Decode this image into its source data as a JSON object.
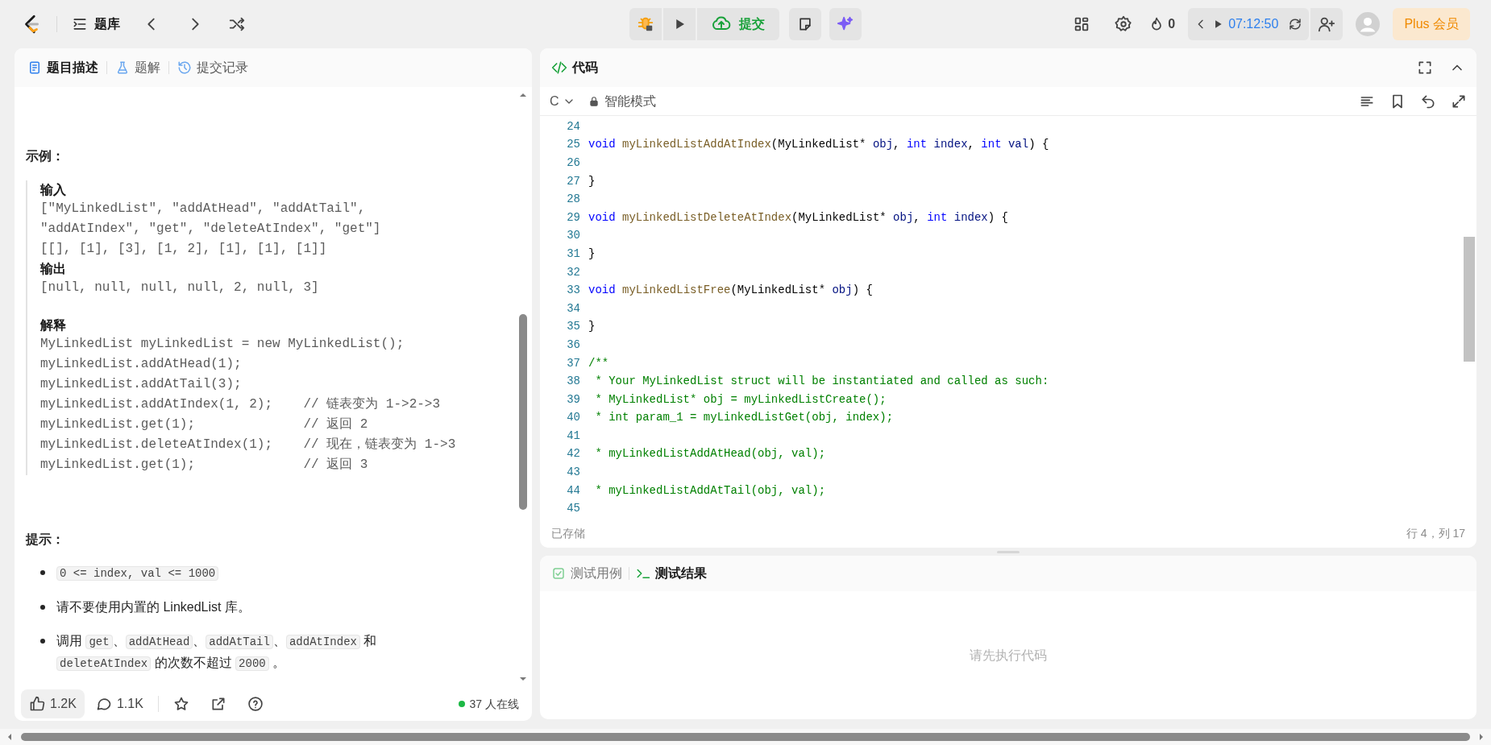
{
  "topbar": {
    "section": "题库",
    "submit": "提交",
    "streak": "0",
    "timer": "07:12:50",
    "plus": "Plus 会员"
  },
  "problem_panel": {
    "tabs": [
      {
        "label": "题目描述",
        "selected": true
      },
      {
        "label": "题解",
        "selected": false
      },
      {
        "label": "提交记录",
        "selected": false
      }
    ],
    "example_heading": "示例：",
    "example": [
      {
        "kind": "label",
        "text": "输入"
      },
      {
        "kind": "code",
        "text": "[\"MyLinkedList\", \"addAtHead\", \"addAtTail\","
      },
      {
        "kind": "code",
        "text": "\"addAtIndex\", \"get\", \"deleteAtIndex\", \"get\"]"
      },
      {
        "kind": "code",
        "text": "[[], [1], [3], [1, 2], [1], [1], [1]]"
      },
      {
        "kind": "label",
        "text": "输出"
      },
      {
        "kind": "code",
        "text": "[null, null, null, null, 2, null, 3]"
      },
      {
        "kind": "gap"
      },
      {
        "kind": "label",
        "text": "解释"
      },
      {
        "kind": "code",
        "text": "MyLinkedList myLinkedList = new MyLinkedList();"
      },
      {
        "kind": "code",
        "text": "myLinkedList.addAtHead(1);"
      },
      {
        "kind": "code",
        "text": "myLinkedList.addAtTail(3);"
      },
      {
        "kind": "code",
        "text": "myLinkedList.addAtIndex(1, 2);    // 链表变为 1->2->3"
      },
      {
        "kind": "code",
        "text": "myLinkedList.get(1);              // 返回 2"
      },
      {
        "kind": "code",
        "text": "myLinkedList.deleteAtIndex(1);    // 现在，链表变为 1->3"
      },
      {
        "kind": "code",
        "text": "myLinkedList.get(1);              // 返回 3"
      }
    ],
    "hints_heading": "提示：",
    "hints": [
      {
        "segments": [
          {
            "text": "0 <= index, val <= 1000",
            "code": true
          }
        ]
      },
      {
        "segments": [
          {
            "text": "请不要使用内置的 LinkedList 库。",
            "code": false
          }
        ]
      },
      {
        "segments": [
          {
            "text": "调用 ",
            "code": false
          },
          {
            "text": "get",
            "code": true
          },
          {
            "text": "、",
            "code": false
          },
          {
            "text": "addAtHead",
            "code": true
          },
          {
            "text": "、",
            "code": false
          },
          {
            "text": "addAtTail",
            "code": true
          },
          {
            "text": "、",
            "code": false
          },
          {
            "text": "addAtIndex",
            "code": true
          },
          {
            "text": " 和 ",
            "code": false
          },
          {
            "text": "deleteAtIndex",
            "code": true
          },
          {
            "text": " 的次数不超过 ",
            "code": false
          },
          {
            "text": "2000",
            "code": true
          },
          {
            "text": " 。",
            "code": false
          }
        ]
      }
    ],
    "footer": {
      "likes": "1.2K",
      "comments": "1.1K",
      "online": "37 人在线"
    }
  },
  "editor": {
    "title": "代码",
    "language": "C",
    "mode": "智能模式",
    "lines": [
      {
        "number": "24"
      },
      {
        "number": "25",
        "tokens": [
          {
            "text": "void ",
            "kind": "kw"
          },
          {
            "text": "myLinkedListAddAtIndex",
            "kind": "fn"
          },
          {
            "text": "(MyLinkedList* ",
            "kind": "plain"
          },
          {
            "text": "obj",
            "kind": "var"
          },
          {
            "text": ", ",
            "kind": "plain"
          },
          {
            "text": "int ",
            "kind": "kw"
          },
          {
            "text": "index",
            "kind": "var"
          },
          {
            "text": ", ",
            "kind": "plain"
          },
          {
            "text": "int ",
            "kind": "kw"
          },
          {
            "text": "val",
            "kind": "var"
          },
          {
            "text": ") {",
            "kind": "plain"
          }
        ]
      },
      {
        "number": "26"
      },
      {
        "number": "27",
        "tokens": [
          {
            "text": "}",
            "kind": "plain"
          }
        ]
      },
      {
        "number": "28"
      },
      {
        "number": "29",
        "tokens": [
          {
            "text": "void ",
            "kind": "kw"
          },
          {
            "text": "myLinkedListDeleteAtIndex",
            "kind": "fn"
          },
          {
            "text": "(MyLinkedList* ",
            "kind": "plain"
          },
          {
            "text": "obj",
            "kind": "var"
          },
          {
            "text": ", ",
            "kind": "plain"
          },
          {
            "text": "int ",
            "kind": "kw"
          },
          {
            "text": "index",
            "kind": "var"
          },
          {
            "text": ") {",
            "kind": "plain"
          }
        ]
      },
      {
        "number": "30"
      },
      {
        "number": "31",
        "tokens": [
          {
            "text": "}",
            "kind": "plain"
          }
        ]
      },
      {
        "number": "32"
      },
      {
        "number": "33",
        "tokens": [
          {
            "text": "void ",
            "kind": "kw"
          },
          {
            "text": "myLinkedListFree",
            "kind": "fn"
          },
          {
            "text": "(MyLinkedList* ",
            "kind": "plain"
          },
          {
            "text": "obj",
            "kind": "var"
          },
          {
            "text": ") {",
            "kind": "plain"
          }
        ]
      },
      {
        "number": "34"
      },
      {
        "number": "35",
        "tokens": [
          {
            "text": "}",
            "kind": "plain"
          }
        ]
      },
      {
        "number": "36"
      },
      {
        "number": "37",
        "tokens": [
          {
            "text": "/**",
            "kind": "comment"
          }
        ]
      },
      {
        "number": "38",
        "tokens": [
          {
            "text": " * Your MyLinkedList struct will be instantiated and called as such:",
            "kind": "comment"
          }
        ]
      },
      {
        "number": "39",
        "tokens": [
          {
            "text": " * MyLinkedList* obj = myLinkedListCreate();",
            "kind": "comment"
          }
        ]
      },
      {
        "number": "40",
        "tokens": [
          {
            "text": " * int param_1 = myLinkedListGet(obj, index);",
            "kind": "comment"
          }
        ]
      },
      {
        "number": "41"
      },
      {
        "number": "42",
        "tokens": [
          {
            "text": " * myLinkedListAddAtHead(obj, val);",
            "kind": "comment"
          }
        ]
      },
      {
        "number": "43"
      },
      {
        "number": "44",
        "tokens": [
          {
            "text": " * myLinkedListAddAtTail(obj, val);",
            "kind": "comment"
          }
        ]
      },
      {
        "number": "45"
      }
    ],
    "status": "已存储",
    "cursor": "行 4，列 17"
  },
  "test_panel": {
    "tabs": [
      {
        "label": "测试用例",
        "selected": false
      },
      {
        "label": "测试结果",
        "selected": true
      }
    ],
    "empty_message": "请先执行代码"
  }
}
